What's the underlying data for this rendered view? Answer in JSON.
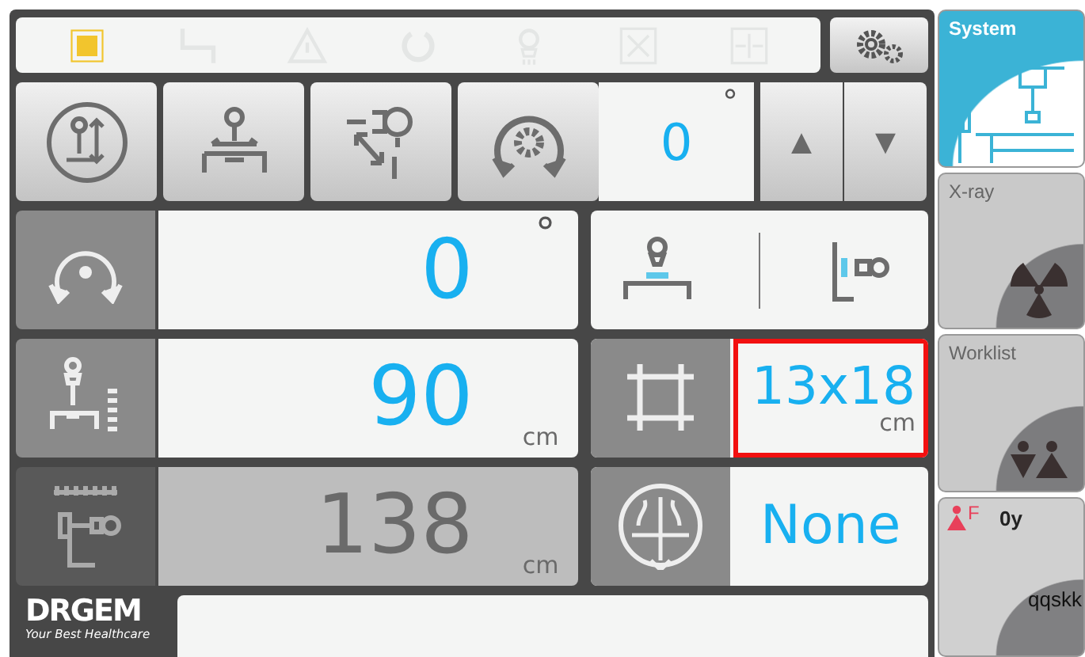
{
  "status_lights": [
    {
      "kind": "stop",
      "on": true
    },
    {
      "kind": "power",
      "on": false
    },
    {
      "kind": "warning",
      "on": false
    },
    {
      "kind": "ring",
      "on": false
    },
    {
      "kind": "tube",
      "on": false
    },
    {
      "kind": "collimator",
      "on": false
    },
    {
      "kind": "detector",
      "on": false
    }
  ],
  "angle": {
    "value": "0",
    "unit": "°",
    "up": "▲",
    "down": "▼"
  },
  "rotation": {
    "value": "0",
    "unit": "°"
  },
  "sid": {
    "value": "90",
    "unit": "cm",
    "disabled": false
  },
  "field_size": {
    "value": "13x18",
    "unit": "cm",
    "selected": true
  },
  "distance": {
    "value": "138",
    "unit": "cm",
    "disabled": true
  },
  "grid": {
    "value": "None"
  },
  "logo": {
    "name": "DRGEM",
    "tagline": "Your Best Healthcare"
  },
  "tabs": [
    {
      "label": "System",
      "kind": "system",
      "selected": true
    },
    {
      "label": "X-ray",
      "kind": "xray",
      "selected": false
    },
    {
      "label": "Worklist",
      "kind": "worklist",
      "selected": false
    }
  ],
  "patient": {
    "sex": "F",
    "age": "0y",
    "name": "qqskk"
  }
}
